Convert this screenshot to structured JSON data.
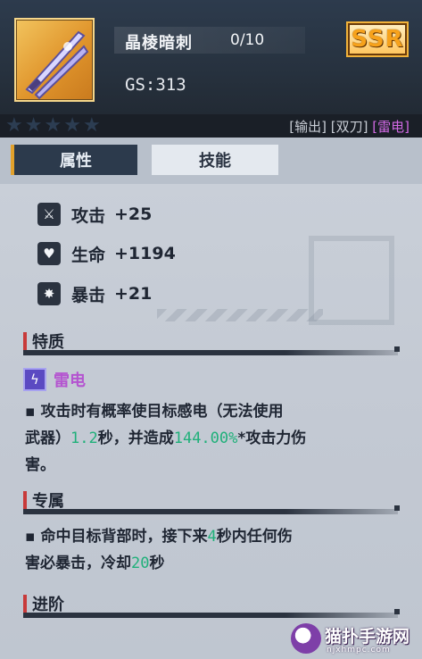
{
  "weapon": {
    "name": "晶棱暗刺",
    "level": "0/10",
    "gs": "GS:313",
    "rarity": "SSR"
  },
  "stars": {
    "count": 5,
    "icon": "star-icon"
  },
  "tags": {
    "output": "[输出]",
    "dual_blades": "[双刀]",
    "thunder": "[雷电]"
  },
  "tabs": {
    "attributes": "属性",
    "skills": "技能"
  },
  "stats": [
    {
      "icon": "sword-icon",
      "label": "攻击",
      "value": "+25"
    },
    {
      "icon": "heart-icon",
      "label": "生命",
      "value": "+1194"
    },
    {
      "icon": "burst-icon",
      "label": "暴击",
      "value": "+21"
    }
  ],
  "traits": {
    "title": "特质",
    "name": "雷电",
    "desc_1": "攻击时有概率使目标感电（无法使用",
    "desc_2a": "武器）",
    "desc_2_duration": "1.2",
    "desc_2b": "秒，并造成",
    "desc_2_percent": "144.00%",
    "desc_2c": "*攻击力伤",
    "desc_3": "害。"
  },
  "exclusive": {
    "title": "专属",
    "desc_1a": "命中目标背部时，接下来",
    "desc_1_seconds": "4",
    "desc_1b": "秒内任何伤",
    "desc_2a": "害必暴击，冷却",
    "desc_2_cooldown": "20",
    "desc_2b": "秒"
  },
  "advance": {
    "title": "进阶"
  },
  "site": {
    "name": "猫扑手游网",
    "url": "njxhmpc.com"
  },
  "colors": {
    "rarity_gold": "#f7a21b",
    "thunder_purple": "#b454d0",
    "highlight_green": "#20b07a",
    "section_red": "#c83a3a"
  }
}
